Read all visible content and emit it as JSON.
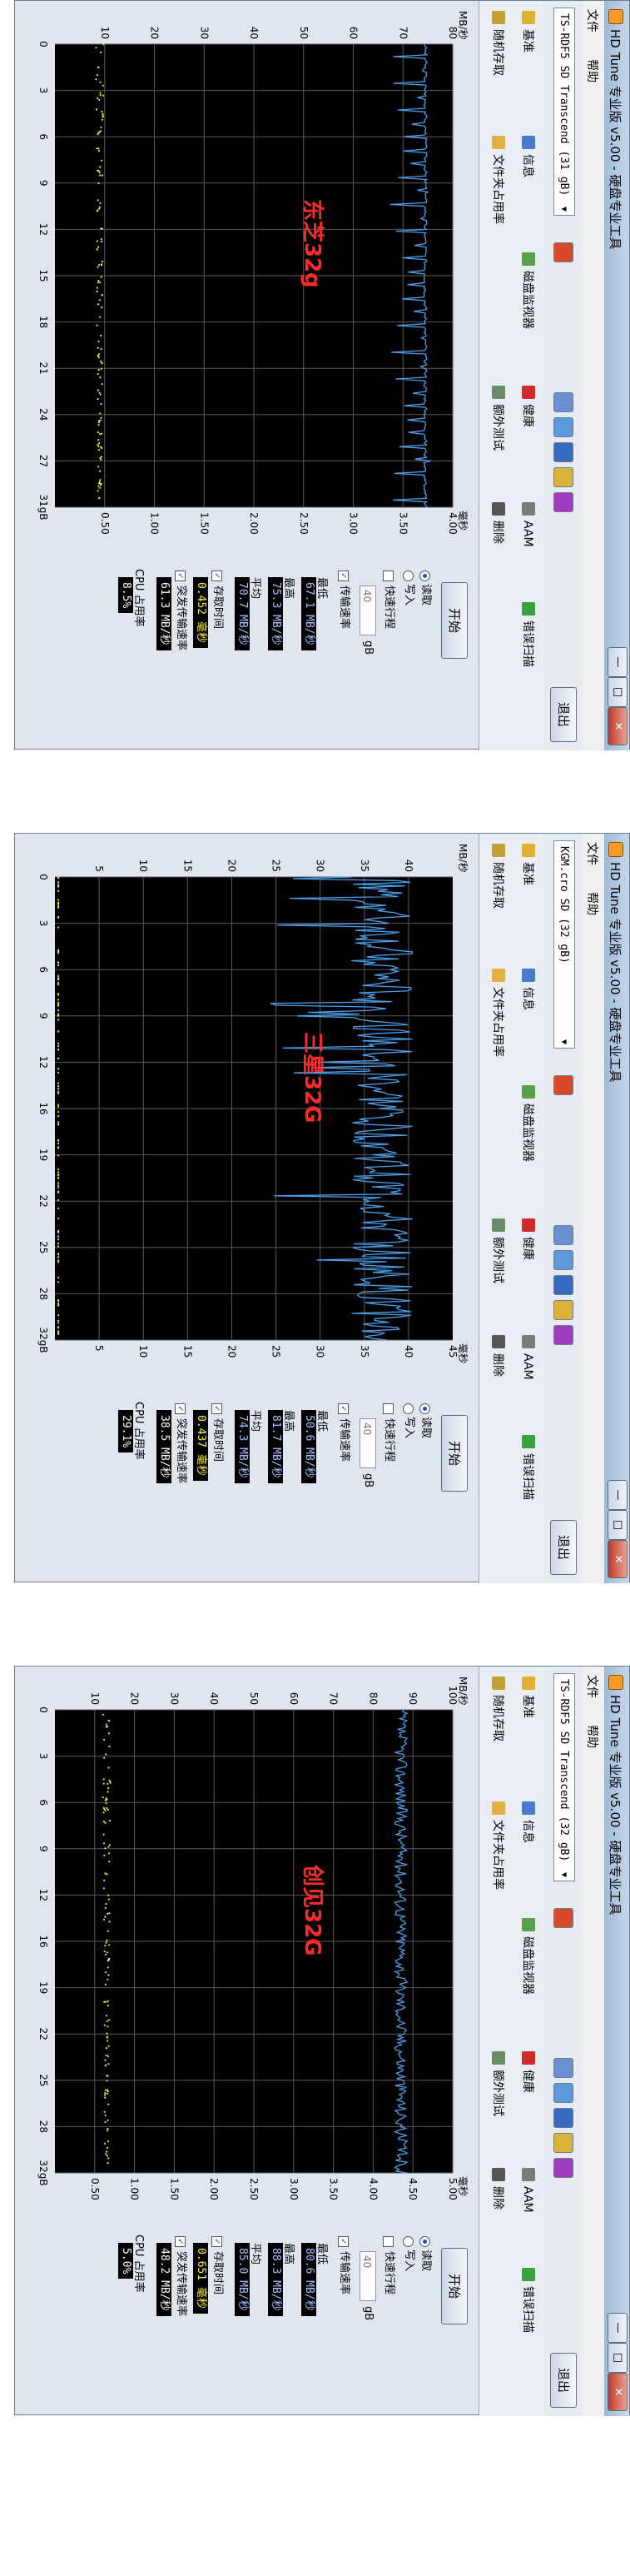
{
  "app_title": "HD Tune 专业版 v5.00 - 硬盘专业工具",
  "menu": {
    "file": "文件",
    "help": "帮助"
  },
  "exit_label": "退出",
  "tabs": [
    {
      "label": "基准"
    },
    {
      "label": "信息"
    },
    {
      "label": "磁盘监视器"
    },
    {
      "label": "健康"
    },
    {
      "label": "AAM"
    },
    {
      "label": "错误扫描"
    },
    {
      "label": "随机存取"
    },
    {
      "label": "文件夹占用率"
    },
    {
      "label": "额外测试"
    },
    {
      "label": "删除"
    }
  ],
  "side_labels": {
    "start": "开始",
    "read": "读取",
    "write": "写入",
    "fast_mode": "快速行程",
    "gb_unit": "gB",
    "spin_value": "40",
    "transfer": "传输速率",
    "min": "最低",
    "max": "最高",
    "avg": "平均",
    "access": "存取时间",
    "burst": "突发传输速率",
    "cpu": "CPU 占用率"
  },
  "panels": [
    {
      "drive": "TS-RDF5 SD  Transcend",
      "drive_size": "(31 gB)",
      "overlay": "东芝32g",
      "y_unit": "MB/秒",
      "y_ticks": [
        "80",
        "70",
        "60",
        "50",
        "40",
        "30",
        "20",
        "10"
      ],
      "ms_unit": "毫秒",
      "ms_ticks": [
        "4.00",
        "3.50",
        "3.00",
        "2.50",
        "2.00",
        "1.50",
        "1.00",
        "0.50"
      ],
      "x_ticks": [
        "0",
        "3",
        "6",
        "9",
        "12",
        "15",
        "18",
        "21",
        "24",
        "27",
        "31gB"
      ],
      "min": "67.1 MB/秒",
      "max": "75.3 MB/秒",
      "avg": "70.7 MB/秒",
      "access": "0.452 毫秒",
      "burst": "61.3 MB/秒",
      "cpu": "8.5%",
      "chart_data": {
        "type": "line",
        "series": [
          {
            "kind": "transfer",
            "pattern": "saw",
            "base": 74.5,
            "amp": 7.2,
            "period": 0.9,
            "unit": "MB/s"
          },
          {
            "kind": "access",
            "pattern": "scatter",
            "value_ms": 0.45,
            "unit": "ms"
          }
        ],
        "ylim": [
          0,
          80
        ],
        "ylim2": [
          0,
          4
        ],
        "xlim": [
          0,
          31
        ]
      }
    },
    {
      "drive": "KGM.cro SD  (32 gB)",
      "drive_size": "",
      "overlay": "三星32G",
      "y_unit": "MB/秒",
      "y_ticks": [
        "40",
        "35",
        "30",
        "25",
        "20",
        "15",
        "10",
        "5"
      ],
      "ms_unit": "毫秒",
      "ms_ticks": [
        "45",
        "40",
        "35",
        "30",
        "25",
        "20",
        "15",
        "10",
        "5"
      ],
      "x_ticks": [
        "0",
        "3",
        "6",
        "9",
        "12",
        "16",
        "19",
        "22",
        "25",
        "28",
        "32gB"
      ],
      "min": "50.6 MB/秒",
      "max": "81.7 MB/秒",
      "avg": "74.3 MB/秒",
      "access": "0.437 毫秒",
      "burst": "38.5 MB/秒",
      "cpu": "29.1%",
      "chart_data": {
        "type": "line",
        "series": [
          {
            "kind": "transfer",
            "pattern": "noisy",
            "base": 37.0,
            "amp": 3.5,
            "period": 0.35,
            "unit": "MB/s"
          },
          {
            "kind": "access",
            "pattern": "flat",
            "value_ms": 0.44,
            "unit": "ms"
          }
        ],
        "ylim": [
          0,
          45
        ],
        "ylim2": [
          0,
          45
        ],
        "xlim": [
          0,
          32
        ]
      }
    },
    {
      "drive": "TS-RDF5 SD  Transcend",
      "drive_size": "(32 gB)",
      "overlay": "创见32G",
      "y_unit": "MB/秒",
      "y_ticks": [
        "100",
        "90",
        "80",
        "70",
        "60",
        "50",
        "40",
        "30",
        "20",
        "10"
      ],
      "ms_unit": "毫秒",
      "ms_ticks": [
        "5.00",
        "4.50",
        "4.00",
        "3.50",
        "3.00",
        "2.50",
        "2.00",
        "1.50",
        "1.00",
        "0.50"
      ],
      "x_ticks": [
        "0",
        "3",
        "6",
        "9",
        "12",
        "16",
        "19",
        "22",
        "25",
        "28",
        "32gB"
      ],
      "min": "80.6 MB/秒",
      "max": "88.3 MB/秒",
      "avg": "85.0 MB/秒",
      "access": "0.651 毫秒",
      "burst": "48.2 MB/秒",
      "cpu": "5.0%",
      "chart_data": {
        "type": "line",
        "series": [
          {
            "kind": "transfer",
            "pattern": "jitter",
            "base": 87.0,
            "amp": 1.6,
            "period": 0.3,
            "unit": "MB/s"
          },
          {
            "kind": "access",
            "pattern": "scatter",
            "value_ms": 0.65,
            "unit": "ms"
          }
        ],
        "ylim": [
          0,
          100
        ],
        "ylim2": [
          0,
          5
        ],
        "xlim": [
          0,
          32
        ]
      }
    }
  ],
  "colors": {
    "chart_bg": "#000000",
    "grid": "#5a5a5a",
    "transfer_line": "#4a9fe8",
    "access_dots": "#e8e83a",
    "overlay_text": "#ff2a2a"
  }
}
